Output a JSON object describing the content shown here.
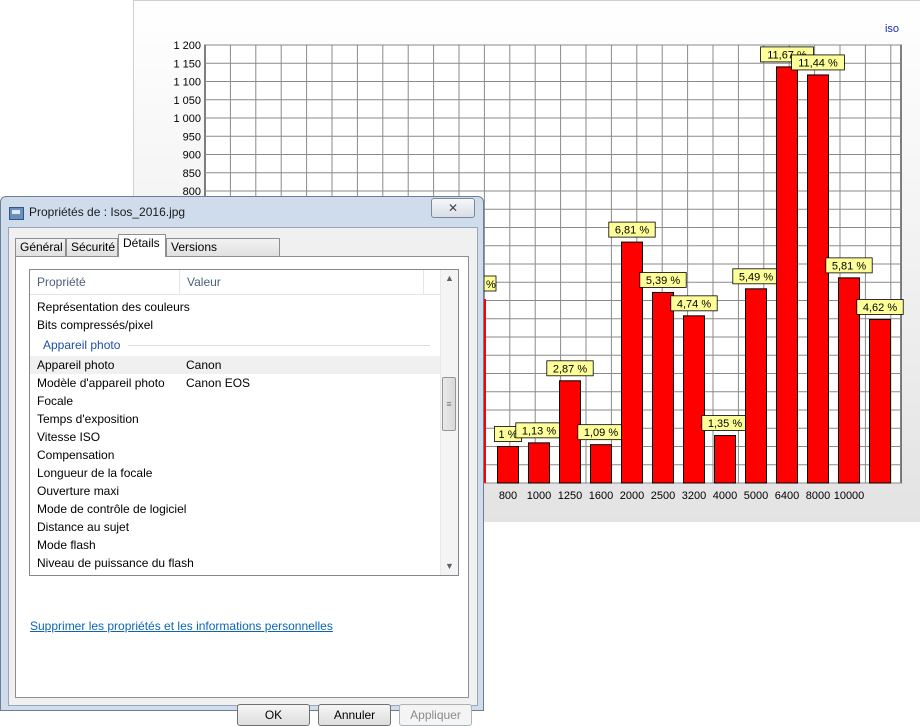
{
  "chart": {
    "series_label": "iso"
  },
  "chart_data": {
    "type": "bar",
    "ylim": [
      0,
      1200
    ],
    "y_ticks": [
      "1 200",
      "1 150",
      "1 100",
      "1 050",
      "1 000",
      "950",
      "900",
      "850",
      "800"
    ],
    "categories": [
      "800",
      "1000",
      "1250",
      "1600",
      "2000",
      "2500",
      "3200",
      "4000",
      "5000",
      "6400",
      "8000",
      "10000"
    ],
    "values": [
      100,
      110,
      280,
      105,
      660,
      522,
      458,
      130,
      532,
      1140,
      1118,
      562
    ],
    "data_labels": [
      "1 %",
      "1,13 %",
      "2,87 %",
      "1,09 %",
      "6,81 %",
      "5,39 %",
      "4,74 %",
      "1,35 %",
      "5,49 %",
      "11,67 %",
      "11,44 %",
      "5,81 %"
    ],
    "extra_bar": {
      "value": 448,
      "label": "4,62 %"
    },
    "partial_label": "%",
    "grid": true,
    "bar_color": "#ff0000"
  },
  "dialog": {
    "title": "Propriétés de : Isos_2016.jpg",
    "close_glyph": "✕",
    "tabs": [
      "Général",
      "Sécurité",
      "Détails",
      "Versions précédentes"
    ],
    "list": {
      "header_property": "Propriété",
      "header_value": "Valeur",
      "rows_before": [
        {
          "key": "Représentation des couleurs",
          "value": ""
        },
        {
          "key": "Bits compressés/pixel",
          "value": ""
        }
      ],
      "group_title": "Appareil photo",
      "rows_after": [
        {
          "key": "Appareil photo",
          "value": "Canon"
        },
        {
          "key": "Modèle d'appareil photo",
          "value": "Canon EOS"
        },
        {
          "key": "Focale",
          "value": ""
        },
        {
          "key": "Temps d'exposition",
          "value": ""
        },
        {
          "key": "Vitesse ISO",
          "value": ""
        },
        {
          "key": "Compensation",
          "value": ""
        },
        {
          "key": "Longueur de la focale",
          "value": ""
        },
        {
          "key": "Ouverture maxi",
          "value": ""
        },
        {
          "key": "Mode de contrôle de logiciel",
          "value": ""
        },
        {
          "key": "Distance au sujet",
          "value": ""
        },
        {
          "key": "Mode flash",
          "value": ""
        },
        {
          "key": "Niveau de puissance du flash",
          "value": ""
        }
      ]
    },
    "remove_link": "Supprimer les propriétés et les informations personnelles",
    "buttons": {
      "ok": "OK",
      "cancel": "Annuler",
      "apply": "Appliquer"
    }
  }
}
